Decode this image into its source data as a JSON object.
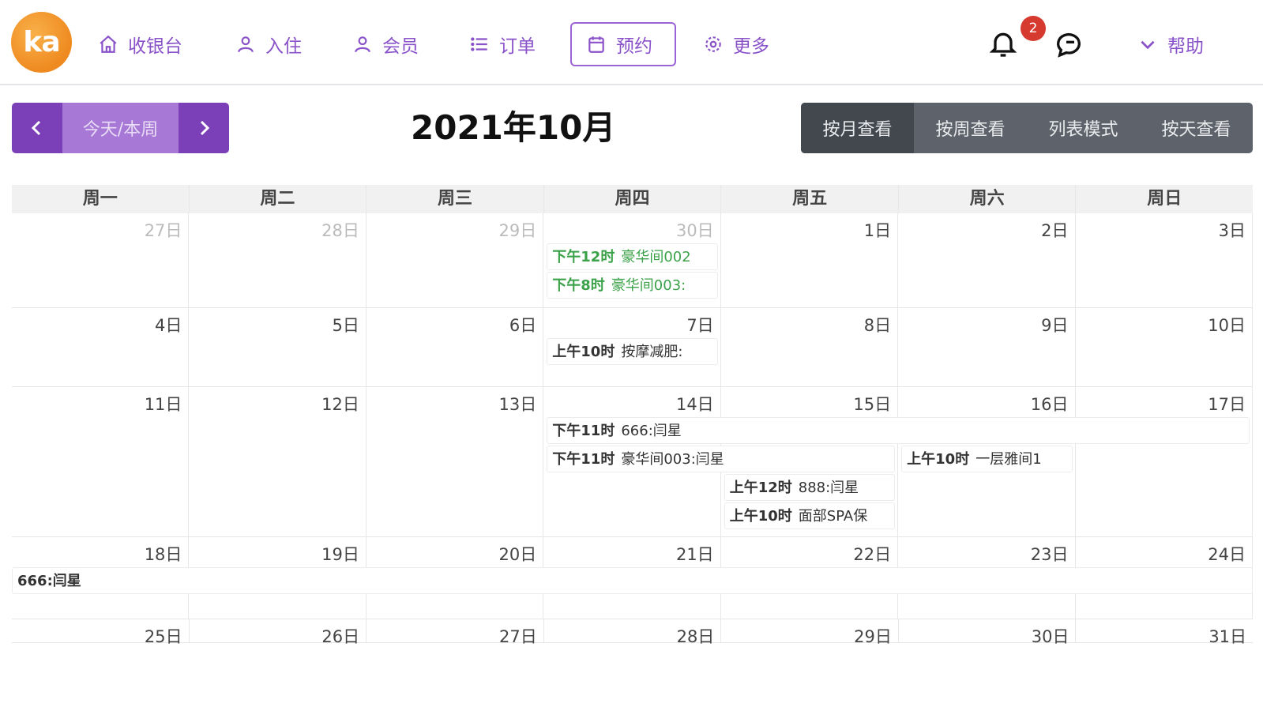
{
  "header": {
    "logo_text": "ka",
    "nav": [
      {
        "label": "收银台",
        "icon": "home-icon"
      },
      {
        "label": "入住",
        "icon": "user-icon"
      },
      {
        "label": "会员",
        "icon": "member-icon"
      },
      {
        "label": "订单",
        "icon": "list-icon"
      },
      {
        "label": "预约",
        "icon": "calendar-icon",
        "active": true
      },
      {
        "label": "更多",
        "icon": "gear-icon"
      }
    ],
    "notification_count": "2",
    "help_label": "帮助"
  },
  "toolbar": {
    "today_label": "今天/本周",
    "month_title": "2021年10月",
    "views": [
      {
        "label": "按月查看",
        "active": true
      },
      {
        "label": "按周查看"
      },
      {
        "label": "列表模式"
      },
      {
        "label": "按天查看"
      }
    ]
  },
  "calendar": {
    "weekdays": [
      "周一",
      "周二",
      "周三",
      "周四",
      "周五",
      "周六",
      "周日"
    ],
    "weeks": [
      {
        "days": [
          {
            "label": "27日",
            "other": true
          },
          {
            "label": "28日",
            "other": true
          },
          {
            "label": "29日",
            "other": true
          },
          {
            "label": "30日",
            "other": true
          },
          {
            "label": "1日"
          },
          {
            "label": "2日"
          },
          {
            "label": "3日"
          }
        ]
      },
      {
        "days": [
          {
            "label": "4日"
          },
          {
            "label": "5日"
          },
          {
            "label": "6日"
          },
          {
            "label": "7日"
          },
          {
            "label": "8日"
          },
          {
            "label": "9日"
          },
          {
            "label": "10日"
          }
        ]
      },
      {
        "days": [
          {
            "label": "11日"
          },
          {
            "label": "12日"
          },
          {
            "label": "13日"
          },
          {
            "label": "14日"
          },
          {
            "label": "15日"
          },
          {
            "label": "16日"
          },
          {
            "label": "17日"
          }
        ]
      },
      {
        "days": [
          {
            "label": "18日"
          },
          {
            "label": "19日"
          },
          {
            "label": "20日"
          },
          {
            "label": "21日"
          },
          {
            "label": "22日"
          },
          {
            "label": "23日"
          },
          {
            "label": "24日"
          }
        ]
      },
      {
        "days": [
          {
            "label": "25日"
          },
          {
            "label": "26日"
          },
          {
            "label": "27日"
          },
          {
            "label": "28日"
          },
          {
            "label": "29日"
          },
          {
            "label": "30日"
          },
          {
            "label": "31日"
          }
        ]
      }
    ],
    "events": [
      {
        "week": 0,
        "start": 3,
        "span": 1,
        "row": 0,
        "time": "下午12时",
        "desc": "豪华间002",
        "color": "green"
      },
      {
        "week": 0,
        "start": 3,
        "span": 1,
        "row": 1,
        "time": "下午8时",
        "desc": "豪华间003:",
        "color": "green"
      },
      {
        "week": 1,
        "start": 3,
        "span": 1,
        "row": 0,
        "time": "上午10时",
        "desc": "按摩减肥:",
        "color": "dark"
      },
      {
        "week": 2,
        "start": 3,
        "span": 4,
        "row": 0,
        "time": "下午11时",
        "desc": "666:闫星",
        "color": "dark"
      },
      {
        "week": 2,
        "start": 3,
        "span": 2,
        "row": 1,
        "time": "下午11时",
        "desc": "豪华间003:闫星",
        "color": "dark"
      },
      {
        "week": 2,
        "start": 5,
        "span": 1,
        "row": 1,
        "time": "上午10时",
        "desc": "一层雅间1",
        "color": "dark"
      },
      {
        "week": 2,
        "start": 4,
        "span": 1,
        "row": 2,
        "time": "上午12时",
        "desc": "888:闫星",
        "color": "dark"
      },
      {
        "week": 2,
        "start": 4,
        "span": 1,
        "row": 3,
        "time": "上午10时",
        "desc": "面部SPA保",
        "color": "dark"
      },
      {
        "week": 3,
        "start": 0,
        "span": 7,
        "row": 0,
        "time": "",
        "desc": "666:闫星",
        "color": "dark"
      }
    ]
  }
}
